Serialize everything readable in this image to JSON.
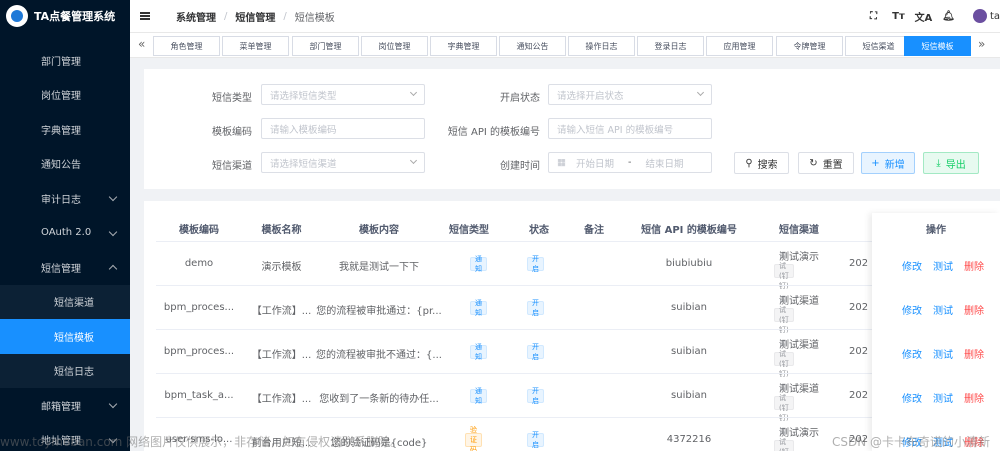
{
  "app": {
    "title": "TA点餐管理系统"
  },
  "sidebar": {
    "items": [
      {
        "label": "部门管理",
        "type": "item"
      },
      {
        "label": "岗位管理",
        "type": "item"
      },
      {
        "label": "字典管理",
        "type": "item"
      },
      {
        "label": "通知公告",
        "type": "item"
      },
      {
        "label": "审计日志",
        "type": "group"
      },
      {
        "label": "OAuth 2.0",
        "type": "group"
      },
      {
        "label": "短信管理",
        "type": "group-open"
      },
      {
        "label": "短信渠道",
        "type": "sub"
      },
      {
        "label": "短信模板",
        "type": "sub-active"
      },
      {
        "label": "短信日志",
        "type": "sub"
      },
      {
        "label": "邮箱管理",
        "type": "group"
      },
      {
        "label": "地址管理",
        "type": "group"
      }
    ]
  },
  "header": {
    "breadcrumb": [
      "系统管理",
      "短信管理",
      "短信模板"
    ],
    "icons": [
      "fullscreen-icon",
      "font-size-icon",
      "translate-icon",
      "bell-icon"
    ],
    "user_name": "ta"
  },
  "tags": [
    "角色管理",
    "菜单管理",
    "部门管理",
    "岗位管理",
    "字典管理",
    "通知公告",
    "操作日志",
    "登录日志",
    "应用管理",
    "令牌管理",
    "短信渠道",
    "短信模板"
  ],
  "active_tag": "短信模板",
  "search": {
    "sms_type_label": "短信类型",
    "sms_type_placeholder": "请选择短信类型",
    "status_label": "开启状态",
    "status_placeholder": "请选择开启状态",
    "code_label": "模板编码",
    "code_placeholder": "请输入模板编码",
    "api_label": "短信 API 的模板编号",
    "api_placeholder": "请输入短信 API 的模板编号",
    "channel_label": "短信渠道",
    "channel_placeholder": "请选择短信渠道",
    "time_label": "创建时间",
    "time_start": "开始日期",
    "time_sep": "-",
    "time_end": "结束日期",
    "search_btn": "搜索",
    "reset_btn": "重置",
    "add_btn": "新增",
    "export_btn": "导出"
  },
  "table": {
    "headers": [
      "模板编码",
      "模板名称",
      "模板内容",
      "短信类型",
      "状态",
      "备注",
      "短信 API 的模板编号",
      "短信渠道",
      "操作"
    ],
    "rows": [
      {
        "code": "demo",
        "name": "演示模板",
        "content": "我就是测试一下下",
        "type": "通知",
        "type_color": "blue",
        "status": "开启",
        "api": "biubiubiu",
        "channel": "测试演示",
        "channel_tag": "调试(钉钉)",
        "time": "202"
      },
      {
        "code": "bpm_proces...",
        "name": "【工作流】...",
        "content": "您的流程被审批通过：{pr...",
        "type": "通知",
        "type_color": "blue",
        "status": "开启",
        "api": "suibian",
        "channel": "测试渠道",
        "channel_tag": "调试(钉钉)",
        "time": "202"
      },
      {
        "code": "bpm_proces...",
        "name": "【工作流】...",
        "content": "您的流程被审批不通过：{...",
        "type": "通知",
        "type_color": "blue",
        "status": "开启",
        "api": "suibian",
        "channel": "测试渠道",
        "channel_tag": "调试(钉钉)",
        "time": "202"
      },
      {
        "code": "bpm_task_a...",
        "name": "【工作流】...",
        "content": "您收到了一条新的待办任...",
        "type": "通知",
        "type_color": "blue",
        "status": "开启",
        "api": "suibian",
        "channel": "测试渠道",
        "channel_tag": "调试(钉钉)",
        "time": "202"
      },
      {
        "code": "user-sms-lo...",
        "name": "前台用户短...",
        "content": "您的验证码是{code}",
        "type": "验证码",
        "type_color": "orange",
        "status": "开启",
        "api": "4372216",
        "channel": "测试演示",
        "channel_tag": "调试(钉钉)",
        "time": "202"
      }
    ],
    "ops": [
      "修改",
      "测试",
      "删除"
    ]
  },
  "watermark": {
    "left": "www.toymoban.com 网络图片仅供展示，非存储，如有侵权请联系删除。",
    "right": "CSDN @卡卡布奇诺的小清新"
  }
}
